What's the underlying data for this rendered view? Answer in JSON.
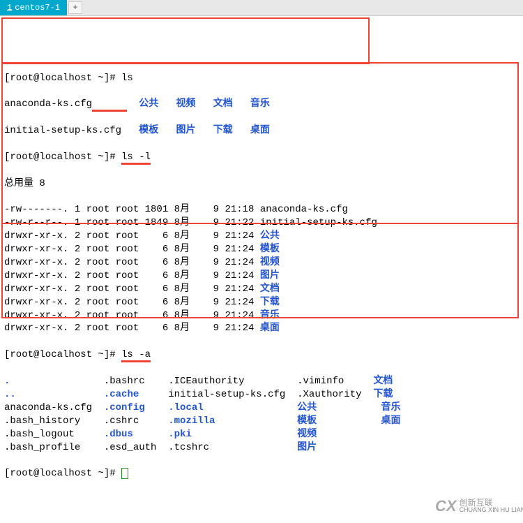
{
  "tab": {
    "index": "1",
    "name": "centos7-1",
    "new_tab": "+"
  },
  "prompt": "[root@localhost ~]# ",
  "cmds": {
    "ls": "ls",
    "lsl": "ls -l",
    "lsa": "ls -a"
  },
  "ls_simple": {
    "file1": "anaconda-ks.cfg",
    "file2": "initial-setup-ks.cfg",
    "dirs": [
      "公共",
      "视频",
      "文档",
      "音乐",
      "模板",
      "图片",
      "下载",
      "桌面"
    ]
  },
  "lsl": {
    "total": "总用量 8",
    "rows": [
      {
        "perm": "-rw-------.",
        "n": "1",
        "o": "root",
        "g": "root",
        "sz": "1801",
        "mo": "8月",
        "d": "9",
        "t": "21:18",
        "name": "anaconda-ks.cfg",
        "dir": false
      },
      {
        "perm": "-rw-r--r--.",
        "n": "1",
        "o": "root",
        "g": "root",
        "sz": "1849",
        "mo": "8月",
        "d": "9",
        "t": "21:22",
        "name": "initial-setup-ks.cfg",
        "dir": false
      },
      {
        "perm": "drwxr-xr-x.",
        "n": "2",
        "o": "root",
        "g": "root",
        "sz": "6",
        "mo": "8月",
        "d": "9",
        "t": "21:24",
        "name": "公共",
        "dir": true
      },
      {
        "perm": "drwxr-xr-x.",
        "n": "2",
        "o": "root",
        "g": "root",
        "sz": "6",
        "mo": "8月",
        "d": "9",
        "t": "21:24",
        "name": "模板",
        "dir": true
      },
      {
        "perm": "drwxr-xr-x.",
        "n": "2",
        "o": "root",
        "g": "root",
        "sz": "6",
        "mo": "8月",
        "d": "9",
        "t": "21:24",
        "name": "视频",
        "dir": true
      },
      {
        "perm": "drwxr-xr-x.",
        "n": "2",
        "o": "root",
        "g": "root",
        "sz": "6",
        "mo": "8月",
        "d": "9",
        "t": "21:24",
        "name": "图片",
        "dir": true
      },
      {
        "perm": "drwxr-xr-x.",
        "n": "2",
        "o": "root",
        "g": "root",
        "sz": "6",
        "mo": "8月",
        "d": "9",
        "t": "21:24",
        "name": "文档",
        "dir": true
      },
      {
        "perm": "drwxr-xr-x.",
        "n": "2",
        "o": "root",
        "g": "root",
        "sz": "6",
        "mo": "8月",
        "d": "9",
        "t": "21:24",
        "name": "下载",
        "dir": true
      },
      {
        "perm": "drwxr-xr-x.",
        "n": "2",
        "o": "root",
        "g": "root",
        "sz": "6",
        "mo": "8月",
        "d": "9",
        "t": "21:24",
        "name": "音乐",
        "dir": true
      },
      {
        "perm": "drwxr-xr-x.",
        "n": "2",
        "o": "root",
        "g": "root",
        "sz": "6",
        "mo": "8月",
        "d": "9",
        "t": "21:24",
        "name": "桌面",
        "dir": true
      }
    ]
  },
  "lsa_rows": [
    [
      {
        "t": ".",
        "b": true
      },
      {
        "t": ".bashrc"
      },
      {
        "t": ".ICEauthority"
      },
      {
        "t": ".viminfo"
      },
      {
        "t": "文档",
        "b": true
      }
    ],
    [
      {
        "t": "..",
        "b": true
      },
      {
        "t": ".cache",
        "b": true
      },
      {
        "t": "initial-setup-ks.cfg"
      },
      {
        "t": ".Xauthority"
      },
      {
        "t": "下载",
        "b": true
      }
    ],
    [
      {
        "t": "anaconda-ks.cfg"
      },
      {
        "t": ".config",
        "b": true
      },
      {
        "t": ".local",
        "b": true
      },
      {
        "t": "公共",
        "b": true
      },
      {
        "t": "音乐",
        "b": true
      }
    ],
    [
      {
        "t": ".bash_history"
      },
      {
        "t": ".cshrc"
      },
      {
        "t": ".mozilla",
        "b": true
      },
      {
        "t": "模板",
        "b": true
      },
      {
        "t": "桌面",
        "b": true
      }
    ],
    [
      {
        "t": ".bash_logout"
      },
      {
        "t": ".dbus",
        "b": true
      },
      {
        "t": ".pki",
        "b": true
      },
      {
        "t": "视频",
        "b": true
      },
      {
        "t": ""
      }
    ],
    [
      {
        "t": ".bash_profile"
      },
      {
        "t": ".esd_auth"
      },
      {
        "t": ".tcshrc"
      },
      {
        "t": "图片",
        "b": true
      },
      {
        "t": ""
      }
    ]
  ],
  "logo": {
    "mark": "CX",
    "cn": "创新互联",
    "en": "CHUANG XIN HU LIAN"
  }
}
